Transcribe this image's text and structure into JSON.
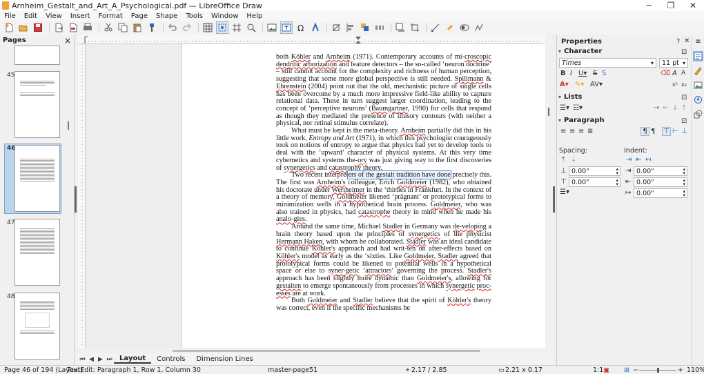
{
  "window": {
    "title": "Arnheim_Gestalt_and_Art_A_Psychological.pdf — LibreOffice Draw",
    "minimize": "─",
    "maximize": "❐",
    "close": "✕"
  },
  "menu": [
    "File",
    "Edit",
    "View",
    "Insert",
    "Format",
    "Page",
    "Shape",
    "Tools",
    "Window",
    "Help"
  ],
  "pages_panel": {
    "title": "Pages",
    "close": "×",
    "thumbs": [
      {
        "label": "45"
      },
      {
        "label": "46"
      },
      {
        "label": "47"
      },
      {
        "label": "48"
      }
    ]
  },
  "document": {
    "paragraphs": [
      {
        "indent": false,
        "segments": [
          {
            "t": "both "
          },
          {
            "t": "Köhler",
            "sq": true
          },
          {
            "t": " and "
          },
          {
            "t": "Arnheim",
            "sq": true
          },
          {
            "t": " (1971). Contemporary accounts of mi-"
          },
          {
            "t": "croscopic dendritic arborization",
            "sq": true
          },
          {
            "t": " and feature detectors – the so-called ‘neuron doctrine’ – still cannot account for the complexity and richness of human perception, suggesting that some more global perspective is still needed. "
          },
          {
            "t": "Spillmann",
            "sq": true
          },
          {
            "t": " & "
          },
          {
            "t": "Ehrenstein",
            "sq": true
          },
          {
            "t": " (2004) point out that the old, mechanistic picture of single cells has been overcome by a much more impressive field-like ability to capture relational data. These in turn suggest larger coordination, leading to the concept of ‘perceptive neurons’ ("
          },
          {
            "t": "Baumgartner",
            "sq": true
          },
          {
            "t": ", 1990) for cells that respond as though they mediated the presence of illusory contours (with neither a physical, nor retinal stimulus correlate)."
          }
        ]
      },
      {
        "indent": true,
        "segments": [
          {
            "t": "What must be kept is the meta-theory. "
          },
          {
            "t": "Arnheim",
            "sq": true
          },
          {
            "t": " partially did this in his little work, "
          },
          {
            "t": "Entropy and Art",
            "it": true
          },
          {
            "t": " (1971), in which this psychologist courageously took on notions of entropy to argue that physics had yet to develop tools to deal with the ‘upward’ character of physical systems. At this very time cybernetics and systems the-"
          },
          {
            "t": "ory",
            "sq": true
          },
          {
            "t": " was just giving way to the first discoveries of "
          },
          {
            "t": "synergetics",
            "sq": true
          },
          {
            "t": " and "
          },
          {
            "t": "catastrophy",
            "sq": true
          },
          {
            "t": " theory."
          }
        ]
      },
      {
        "indent": true,
        "segments": [
          {
            "t": "Two recent interpret"
          },
          {
            "t": "ers of the gestalt tradition have done",
            "sel": true
          },
          {
            "t": " precisely this. The first was "
          },
          {
            "t": "Arnheim's",
            "sq": true
          },
          {
            "t": " colleague, Erich "
          },
          {
            "t": "Goldmeier",
            "sq": true
          },
          {
            "t": " (1982), who obtained his doctorate under "
          },
          {
            "t": "Wertheimer",
            "sq": true
          },
          {
            "t": " in the ‘thirties in Frankfurt. In the context of a theory of memory, "
          },
          {
            "t": "Goldmeier",
            "sq": true
          },
          {
            "t": " likened ‘prägnant’ or prototypical forms to minimization wells in a hypothetical brain process. "
          },
          {
            "t": "Goldmeier",
            "sq": true
          },
          {
            "t": ", who was also trained in physics, had "
          },
          {
            "t": "catastrophe",
            "sq": true
          },
          {
            "t": " theory in mind when he made his "
          },
          {
            "t": "analo-gies.",
            "sq": true
          }
        ]
      },
      {
        "indent": true,
        "segments": [
          {
            "t": "Around the same time, Michael "
          },
          {
            "t": "Stadler",
            "sq": true
          },
          {
            "t": " in Germany was "
          },
          {
            "t": "de-veloping",
            "sq": true
          },
          {
            "t": " a brain theory based upon the principles of "
          },
          {
            "t": "synergetics",
            "sq": true
          },
          {
            "t": " of the physicist "
          },
          {
            "t": "Hermann Haken",
            "sq": true
          },
          {
            "t": ", with whom he collaborated. "
          },
          {
            "t": "Stadler",
            "sq": true
          },
          {
            "t": " was an ideal candidate to continue "
          },
          {
            "t": "Köhler's",
            "sq": true
          },
          {
            "t": " approach and had writ-ten on after-effects based on "
          },
          {
            "t": "Köhler's",
            "sq": true
          },
          {
            "t": " model as early as the ‘sixties. Like "
          },
          {
            "t": "Goldmeier",
            "sq": true
          },
          {
            "t": ", "
          },
          {
            "t": "Stadler",
            "sq": true
          },
          {
            "t": " agreed that prototypical forms could be likened to potential wells in a hypothetical space or else to "
          },
          {
            "t": "syner-getic",
            "sq": true
          },
          {
            "t": " ‘"
          },
          {
            "t": "attractors",
            "sq": true
          },
          {
            "t": "’ governing the process. "
          },
          {
            "t": "Stadler's",
            "sq": true
          },
          {
            "t": " approach has been slightly more dynamic than "
          },
          {
            "t": "Goldmeier's",
            "sq": true
          },
          {
            "t": ", allowing for "
          },
          {
            "t": "gestalten",
            "sq": true
          },
          {
            "t": " to emerge spontaneously from processes in which "
          },
          {
            "t": "synergetic",
            "sq": true
          },
          {
            "t": " "
          },
          {
            "t": "proc-esses",
            "sq": true
          },
          {
            "t": " are at work."
          }
        ]
      },
      {
        "indent": true,
        "segments": [
          {
            "t": "Both "
          },
          {
            "t": "Goldmeier",
            "sq": true
          },
          {
            "t": " and "
          },
          {
            "t": "Stadler",
            "sq": true
          },
          {
            "t": " believe that the spirit of "
          },
          {
            "t": "Köhler's",
            "sq": true
          },
          {
            "t": " theory was correct, even if the specific mechanisms he"
          }
        ]
      }
    ]
  },
  "tabs": [
    "Layout",
    "Controls",
    "Dimension Lines"
  ],
  "status": {
    "page": "Page 46 of 194 (Layout)",
    "edit": "TextEdit: Paragraph 1, Row 1, Column 30",
    "master": "master-page51",
    "position": "2.17 / 2.85",
    "size": "2.21 x 0.17",
    "scale": "1:1",
    "zoom": "110%"
  },
  "properties": {
    "title": "Properties",
    "character": {
      "title": "Character",
      "font_name": "Times",
      "font_size": "11 pt"
    },
    "lists": {
      "title": "Lists"
    },
    "paragraph": {
      "title": "Paragraph",
      "spacing_label": "Spacing:",
      "indent_label": "Indent:",
      "above": "0.00\"",
      "below": "0.00\"",
      "before_text": "0.00\"",
      "after_text": "0.00\"",
      "first_line": "0.00\""
    }
  }
}
